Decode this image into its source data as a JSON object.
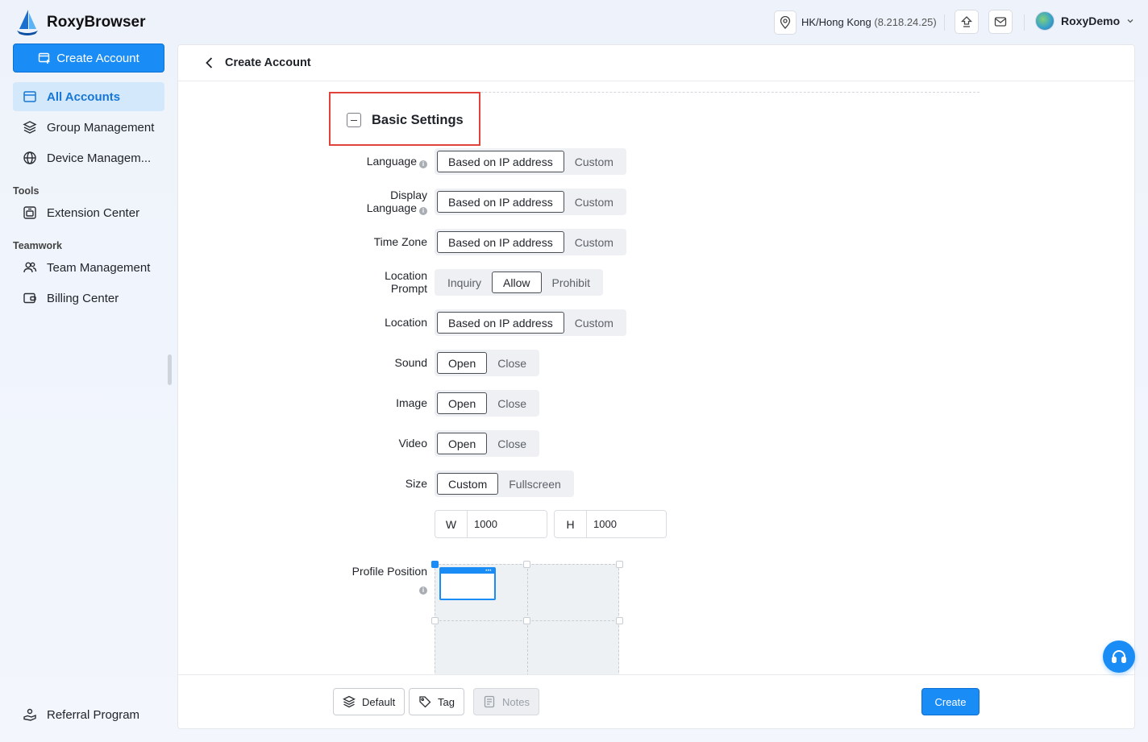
{
  "app": {
    "name": "RoxyBrowser"
  },
  "sidebar": {
    "create_button": "Create Account",
    "items": [
      {
        "label": "All Accounts"
      },
      {
        "label": "Group Management"
      },
      {
        "label": "Device Managem..."
      }
    ],
    "tools_heading": "Tools",
    "tools_items": [
      {
        "label": "Extension Center"
      }
    ],
    "teamwork_heading": "Teamwork",
    "teamwork_items": [
      {
        "label": "Team Management"
      },
      {
        "label": "Billing Center"
      }
    ],
    "referral": "Referral Program"
  },
  "topbar": {
    "location": "HK/Hong Kong",
    "ip": "(8.218.24.25)",
    "user_name": "RoxyDemo"
  },
  "page": {
    "title": "Create Account",
    "section_title": "Basic Settings"
  },
  "fields": {
    "language": {
      "label": "Language",
      "options": [
        "Based on IP address",
        "Custom"
      ],
      "selected": "Based on IP address"
    },
    "display_language": {
      "label_line1": "Display",
      "label_line2": "Language",
      "options": [
        "Based on IP address",
        "Custom"
      ],
      "selected": "Based on IP address"
    },
    "time_zone": {
      "label": "Time Zone",
      "options": [
        "Based on IP address",
        "Custom"
      ],
      "selected": "Based on IP address"
    },
    "location_prompt": {
      "label_line1": "Location",
      "label_line2": "Prompt",
      "options": [
        "Inquiry",
        "Allow",
        "Prohibit"
      ],
      "selected": "Allow"
    },
    "location": {
      "label": "Location",
      "options": [
        "Based on IP address",
        "Custom"
      ],
      "selected": "Based on IP address"
    },
    "sound": {
      "label": "Sound",
      "options": [
        "Open",
        "Close"
      ],
      "selected": "Open"
    },
    "image": {
      "label": "Image",
      "options": [
        "Open",
        "Close"
      ],
      "selected": "Open"
    },
    "video": {
      "label": "Video",
      "options": [
        "Open",
        "Close"
      ],
      "selected": "Open"
    },
    "size": {
      "label": "Size",
      "options": [
        "Custom",
        "Fullscreen"
      ],
      "selected": "Custom"
    },
    "width": {
      "prefix": "W",
      "value": "1000"
    },
    "height": {
      "prefix": "H",
      "value": "1000"
    },
    "profile_position": {
      "label": "Profile Position",
      "selected_cell": "top-left"
    }
  },
  "footer": {
    "default": "Default",
    "tag": "Tag",
    "notes": "Notes",
    "create": "Create"
  },
  "colors": {
    "accent": "#1a8cf5",
    "highlight_border": "#e0433b",
    "active_nav_bg": "#d3e8fb"
  }
}
